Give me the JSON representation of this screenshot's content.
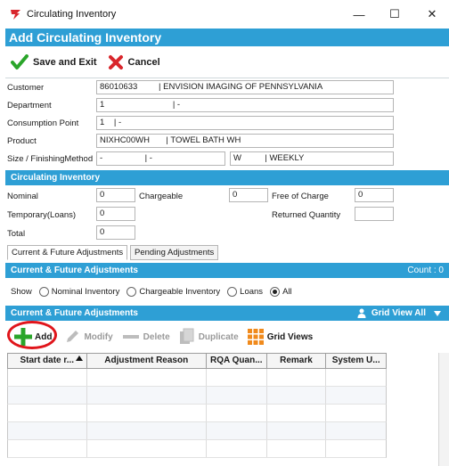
{
  "window": {
    "title": "Circulating Inventory",
    "minimize": "—",
    "maximize": "☐",
    "close": "✕"
  },
  "dialog": {
    "title": "Add Circulating Inventory",
    "save_label": "Save and Exit",
    "cancel_label": "Cancel"
  },
  "fields": {
    "customer": {
      "label": "Customer",
      "value": "86010633         | ENVISION IMAGING OF PENNSYLVANIA"
    },
    "department": {
      "label": "Department",
      "value": "1                             | -"
    },
    "consumption_point": {
      "label": "Consumption Point",
      "value": "1    | -"
    },
    "product": {
      "label": "Product",
      "value": "NIXHC00WH       | TOWEL BATH WH"
    },
    "size_finishing": {
      "label": "Size / FinishingMethod",
      "value1": "-                  | -",
      "value2": "W          | WEEKLY"
    }
  },
  "circulating": {
    "section_title": "Circulating Inventory",
    "nominal": {
      "label": "Nominal",
      "value": "0"
    },
    "chargeable": {
      "label": "Chargeable",
      "value": "0"
    },
    "free_of_charge": {
      "label": "Free of Charge",
      "value": "0"
    },
    "temporary": {
      "label": "Temporary(Loans)",
      "value": "0"
    },
    "returned_quantity": {
      "label": "Returned Quantity",
      "value": ""
    },
    "total": {
      "label": "Total",
      "value": "0"
    }
  },
  "tabs": [
    {
      "label": "Current & Future Adjustments",
      "active": true
    },
    {
      "label": "Pending Adjustments",
      "active": false
    }
  ],
  "adjustments": {
    "section_title": "Current & Future Adjustments",
    "count_label": "Count : 0",
    "show_label": "Show",
    "show_options": [
      {
        "label": "Nominal Inventory",
        "selected": false
      },
      {
        "label": "Chargeable Inventory",
        "selected": false
      },
      {
        "label": "Loans",
        "selected": false
      },
      {
        "label": "All",
        "selected": true
      }
    ]
  },
  "grid_section": {
    "title": "Current & Future Adjustments",
    "grid_view_all": "Grid View All"
  },
  "grid_toolbar": {
    "add": "Add",
    "modify": "Modify",
    "delete": "Delete",
    "duplicate": "Duplicate",
    "grid_views": "Grid Views"
  },
  "grid": {
    "columns": [
      "Start date r...",
      "Adjustment Reason",
      "RQA Quan...",
      "Remark",
      "System U..."
    ],
    "rows": []
  },
  "colors": {
    "accent": "#2e9fd5",
    "add_green": "#2aa52a",
    "cancel_red": "#d9262c",
    "highlight_ring": "#e0151b",
    "grid_views_orange": "#f08a1c"
  }
}
